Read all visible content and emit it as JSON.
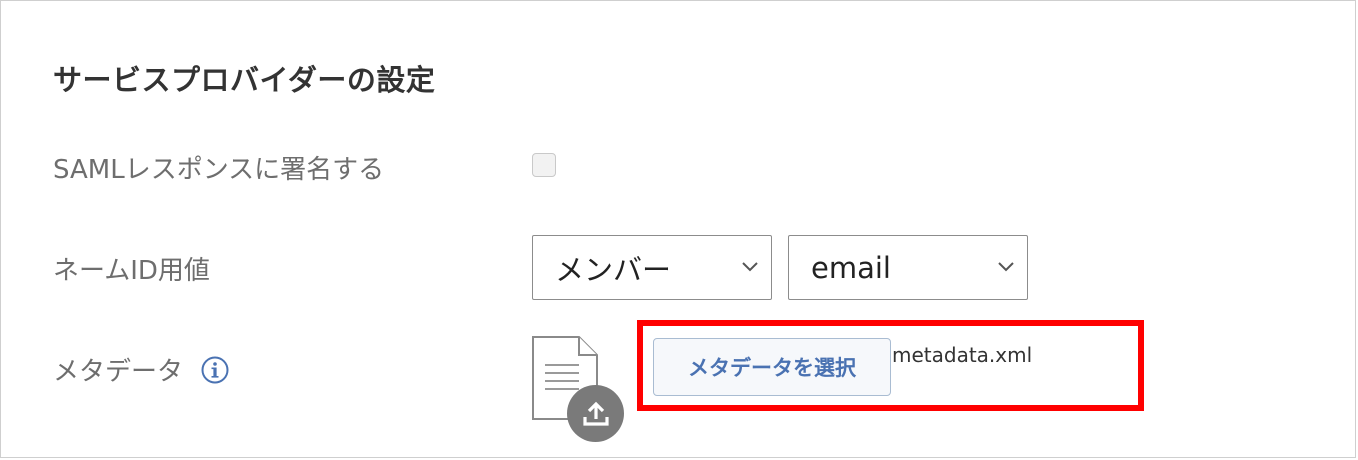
{
  "section": {
    "title": "サービスプロバイダーの設定"
  },
  "saml_sign": {
    "label": "SAMLレスポンスに署名する",
    "checked": false
  },
  "name_id": {
    "label": "ネームID用値",
    "source_value": "メンバー",
    "attribute_value": "email"
  },
  "metadata": {
    "label": "メタデータ",
    "select_button_label": "メタデータを選択",
    "file_name": "metadata.xml"
  },
  "icons": {
    "info": "info-icon",
    "file": "file-document-icon",
    "upload": "upload-icon",
    "chevron": "chevron-down-icon"
  },
  "colors": {
    "accent": "#4a72b2",
    "highlight": "#ff0000",
    "upload_badge": "#7a7a7a"
  }
}
